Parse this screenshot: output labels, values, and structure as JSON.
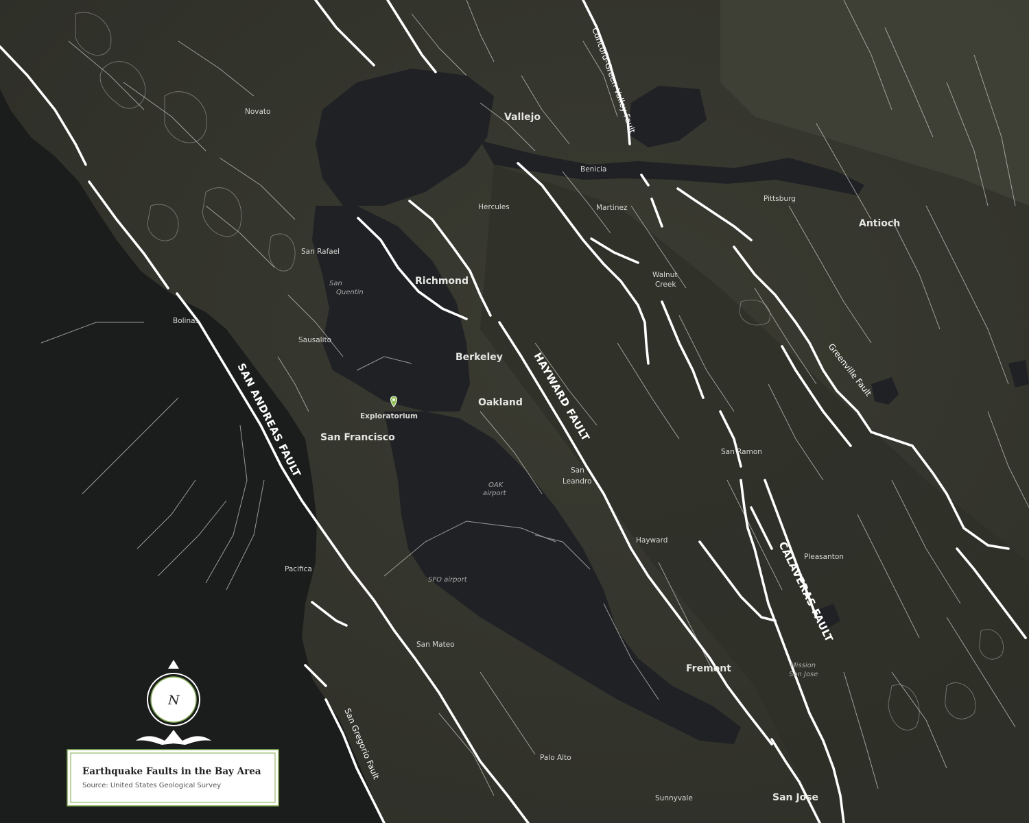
{
  "map": {
    "title": "Earthquake Faults in the Bay Area",
    "source": "Source: United States Geological Survey",
    "compass_label": "N",
    "marker_label": "Exploratorium",
    "colors": {
      "ocean": "#1b1c1c",
      "bay": "#1f2124",
      "land": "#34352c",
      "fault_major": "#ffffff",
      "fault_minor": "#c9c9c4",
      "marker": "#8bc34a",
      "legend_border": "#7fae4a"
    }
  },
  "faults_major": [
    {
      "id": "san-andreas",
      "label": "SAN ANDREAS FAULT"
    },
    {
      "id": "hayward",
      "label": "HAYWARD FAULT"
    },
    {
      "id": "calaveras",
      "label": "CALAVERAS FAULT"
    }
  ],
  "faults_minor": [
    {
      "id": "concord",
      "label": "Concord-Green Valley Fault"
    },
    {
      "id": "greenville",
      "label": "Greenville Fault"
    },
    {
      "id": "san-gregorio",
      "label": "San Gregorio Fault"
    }
  ],
  "cities_major": [
    "Vallejo",
    "Richmond",
    "Berkeley",
    "Oakland",
    "San Francisco",
    "Antioch",
    "Fremont",
    "San Jose"
  ],
  "cities_minor": [
    "Novato",
    "Benicia",
    "Hercules",
    "Martinez",
    "Pittsburg",
    "San Rafael",
    "Walnut",
    "Creek",
    "Bolinas",
    "Sausalito",
    "San Ramon",
    "San",
    "Leandro",
    "Hayward",
    "Pleasanton",
    "Pacifica",
    "San Mateo",
    "Palo Alto",
    "Sunnyvale"
  ],
  "places": [
    "San",
    "Quentin",
    "OAK",
    "airport",
    "SFO airport",
    "Mission",
    "San Jose"
  ]
}
